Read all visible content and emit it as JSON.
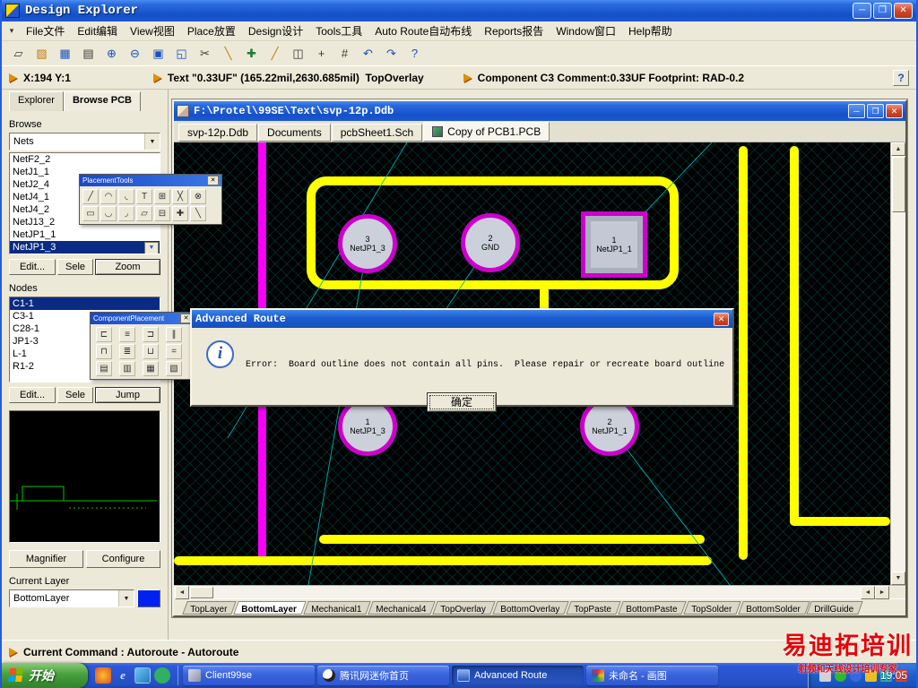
{
  "window": {
    "title": "Design Explorer",
    "controls": {
      "minimize": "─",
      "maximize": "❐",
      "close": "✕"
    }
  },
  "menubar": {
    "grip": "▾",
    "items": [
      {
        "label": "File文件"
      },
      {
        "label": "Edit编辑"
      },
      {
        "label": "View视图"
      },
      {
        "label": "Place放置"
      },
      {
        "label": "Design设计"
      },
      {
        "label": "Tools工具"
      },
      {
        "label": "Auto Route自动布线"
      },
      {
        "label": "Reports报告"
      },
      {
        "label": "Window窗口"
      },
      {
        "label": "Help帮助"
      }
    ]
  },
  "toolbar": {
    "buttons": [
      {
        "name": "component-placement-icon",
        "glyph": "▱"
      },
      {
        "name": "open-document-icon",
        "glyph": "▨",
        "cls": "c-amber"
      },
      {
        "name": "save-icon",
        "glyph": "▦",
        "cls": "c-blue"
      },
      {
        "name": "print-icon",
        "glyph": "▤"
      },
      {
        "name": "zoom-in-icon",
        "glyph": "⊕",
        "cls": "c-blue"
      },
      {
        "name": "zoom-out-icon",
        "glyph": "⊖",
        "cls": "c-blue"
      },
      {
        "name": "zoom-window-icon",
        "glyph": "▣",
        "cls": "c-blue"
      },
      {
        "name": "zoom-fit-icon",
        "glyph": "◱",
        "cls": "c-blue"
      },
      {
        "name": "cut-icon",
        "glyph": "✂"
      },
      {
        "name": "highlight-net-icon",
        "glyph": "╲",
        "cls": "c-amber"
      },
      {
        "name": "cross-probe-icon",
        "glyph": "✚",
        "cls": "c-green"
      },
      {
        "name": "place-track-icon",
        "glyph": "╱",
        "cls": "c-amber"
      },
      {
        "name": "measure-icon",
        "glyph": "◫"
      },
      {
        "name": "origin-icon",
        "glyph": "+"
      },
      {
        "name": "grid-icon",
        "glyph": "#"
      },
      {
        "name": "undo-icon",
        "glyph": "↶",
        "cls": "c-blue"
      },
      {
        "name": "redo-icon",
        "glyph": "↷",
        "cls": "c-blue"
      },
      {
        "name": "help-icon",
        "glyph": "?",
        "cls": "c-blue"
      }
    ]
  },
  "infobar": {
    "coordinates": "X:194 Y:1",
    "text_status": "Text \"0.33UF\" (165.22mil,2630.685mil)  TopOverlay",
    "component_status": "Component C3 Comment:0.33UF Footprint: RAD-0.2",
    "help_button": "?"
  },
  "explorer": {
    "tabs": [
      {
        "label": "Explorer"
      },
      {
        "label": "Browse PCB",
        "cls": "active"
      }
    ],
    "browse_label": "Browse",
    "browse_mode": "Nets",
    "nets": [
      {
        "label": "NetF2_2"
      },
      {
        "label": "NetJ1_1"
      },
      {
        "label": "NetJ2_4"
      },
      {
        "label": "NetJ4_1"
      },
      {
        "label": "NetJ4_2"
      },
      {
        "label": "NetJ13_2"
      },
      {
        "label": "NetJP1_1"
      },
      {
        "label": "NetJP1_3",
        "cls": "selected"
      }
    ],
    "net_buttons": {
      "edit": "Edit...",
      "select": "Sele",
      "zoom": "Zoom"
    },
    "nodes_label": "Nodes",
    "nodes": [
      {
        "label": "C1-1",
        "cls": "selected"
      },
      {
        "label": "C3-1"
      },
      {
        "label": "C28-1"
      },
      {
        "label": "JP1-3"
      },
      {
        "label": "L-1"
      },
      {
        "label": "R1-2"
      }
    ],
    "node_buttons": {
      "edit": "Edit...",
      "select": "Sele",
      "jump": "Jump"
    },
    "magnifier_button": "Magnifier",
    "configure_button": "Configure",
    "current_layer_label": "Current Layer",
    "current_layer": "BottomLayer"
  },
  "palettes": {
    "placement": {
      "title": "PlacementTools",
      "close": "✕",
      "icons": [
        {
          "name": "place-track-icon",
          "glyph": "╱"
        },
        {
          "name": "place-arc-edge-icon",
          "glyph": "◠"
        },
        {
          "name": "place-arc-center-icon",
          "glyph": "◟"
        },
        {
          "name": "place-text-icon",
          "glyph": "T"
        },
        {
          "name": "place-coordinate-icon",
          "glyph": "⊞"
        },
        {
          "name": "place-dimension-icon",
          "glyph": "╳"
        },
        {
          "name": "place-room-icon",
          "glyph": "⊗"
        },
        {
          "name": "place-fill-icon",
          "glyph": "▭"
        },
        {
          "name": "place-full-arc-icon",
          "glyph": "◡"
        },
        {
          "name": "place-corner-icon",
          "glyph": "◞"
        },
        {
          "name": "place-polygon-icon",
          "glyph": "▱"
        },
        {
          "name": "place-pad-icon",
          "glyph": "⊟"
        },
        {
          "name": "place-via-icon",
          "glyph": "✚"
        },
        {
          "name": "place-split-icon",
          "glyph": "╲"
        }
      ]
    },
    "component": {
      "title": "ComponentPlacement",
      "close": "✕",
      "icons": [
        {
          "name": "align-left-icon",
          "glyph": "⊏"
        },
        {
          "name": "align-center-icon",
          "glyph": "≡"
        },
        {
          "name": "align-right-icon",
          "glyph": "⊐"
        },
        {
          "name": "space-horizontal-icon",
          "glyph": "∥"
        },
        {
          "name": "align-top-icon",
          "glyph": "⊓"
        },
        {
          "name": "align-middle-icon",
          "glyph": "≣"
        },
        {
          "name": "align-bottom-icon",
          "glyph": "⊔"
        },
        {
          "name": "space-vertical-icon",
          "glyph": "="
        },
        {
          "name": "arrange-room-icon",
          "glyph": "▤"
        },
        {
          "name": "arrange-rect-icon",
          "glyph": "▥"
        },
        {
          "name": "move-to-grid-icon",
          "glyph": "▦"
        },
        {
          "name": "shove-icon",
          "glyph": "▧"
        }
      ]
    }
  },
  "mdi": {
    "title": "F:\\Protel\\99SE\\Text\\svp-12p.Ddb",
    "controls": {
      "minimize": "─",
      "maximize": "❐",
      "close": "✕"
    },
    "doc_tabs": [
      {
        "label": "svp-12p.Ddb"
      },
      {
        "label": "Documents"
      },
      {
        "label": "pcbSheet1.Sch"
      },
      {
        "label": "Copy of PCB1.PCB",
        "cls": "active"
      }
    ]
  },
  "pcb": {
    "pads": [
      {
        "num": "3",
        "net": "NetJP1_3"
      },
      {
        "num": "2",
        "net": "GND"
      },
      {
        "num": "1",
        "net": "NetJP1_1"
      },
      {
        "num": "1",
        "net": "NetJP1_3"
      },
      {
        "num": "2",
        "net": "NetJP1_1"
      }
    ],
    "layer_tabs": [
      {
        "label": "TopLayer"
      },
      {
        "label": "BottomLayer",
        "cls": "active"
      },
      {
        "label": "Mechanical1"
      },
      {
        "label": "Mechanical4"
      },
      {
        "label": "TopOverlay"
      },
      {
        "label": "BottomOverlay"
      },
      {
        "label": "TopPaste"
      },
      {
        "label": "BottomPaste"
      },
      {
        "label": "TopSolder"
      },
      {
        "label": "BottomSolder"
      },
      {
        "label": "DrillGuide"
      }
    ],
    "colors": {
      "trace": "#ffff00",
      "highlight": "#fa00fa",
      "board_bg": "#000000",
      "grid": "#0e4242",
      "pad_fill": "#ccd0da",
      "ratsnest": "#00b0b0"
    }
  },
  "dialog": {
    "title": "Advanced Route",
    "close": "✕",
    "message": "Error:  Board outline does not contain all pins.  Please repair or recreate board outline",
    "ok_label": "确定"
  },
  "statusbar": {
    "text": "Current Command : Autoroute - Autoroute"
  },
  "taskbar": {
    "start_label": "开始",
    "quicklaunch": [
      {
        "name": "media-player-icon",
        "cls": "q-media"
      },
      {
        "name": "ie-icon",
        "cls": "q-ie",
        "glyph": "e"
      },
      {
        "name": "show-desktop-icon",
        "cls": "q-desk"
      },
      {
        "name": "msn-icon",
        "cls": "q-msn"
      }
    ],
    "tasks": [
      {
        "label": "Client99se",
        "cls": "t-client"
      },
      {
        "label": "腾讯网迷你首页",
        "cls": "t-qq"
      },
      {
        "label": "Advanced Route",
        "cls": "t-route active"
      },
      {
        "label": "未命名 - 画图",
        "cls": "t-paint"
      }
    ],
    "tray": [
      {
        "name": "volume-icon",
        "cls": "tr-gray"
      },
      {
        "name": "antivirus-icon",
        "cls": "tr-green"
      },
      {
        "name": "qq-tray-icon",
        "cls": "tr-blue"
      },
      {
        "name": "messenger-icon",
        "cls": "tr-yellow"
      },
      {
        "name": "network-icon",
        "cls": "tr-teal"
      },
      {
        "name": "security-icon",
        "cls": "tr-red"
      }
    ],
    "clock": "19:05"
  },
  "watermark": {
    "line1": "易迪拓培训",
    "line2": "射频和天线设计培训专家"
  },
  "ui": {
    "arrow_up": "▲",
    "arrow_down": "▼",
    "arrow_left": "◄",
    "arrow_right": "►",
    "combo_arrow": "▼"
  }
}
